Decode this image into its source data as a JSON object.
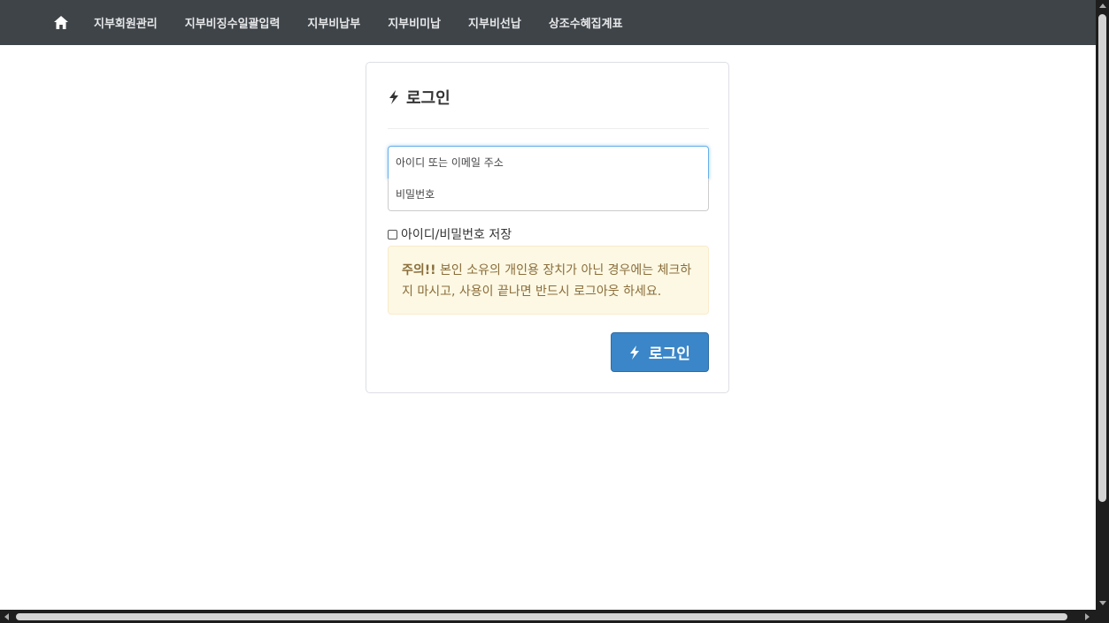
{
  "navbar": {
    "home_icon": "home-icon",
    "items": [
      {
        "label": "지부회원관리"
      },
      {
        "label": "지부비징수일괄입력"
      },
      {
        "label": "지부비납부"
      },
      {
        "label": "지부비미납"
      },
      {
        "label": "지부비선납"
      },
      {
        "label": "상조수혜집계표"
      }
    ]
  },
  "login": {
    "title_icon": "bolt-icon",
    "title": "로그인",
    "id_placeholder": "아이디 또는 이메일 주소",
    "password_placeholder": "비밀번호",
    "remember_label": "아이디/비밀번호 저장",
    "remember_checked": false,
    "alert_strong": "주의!!",
    "alert_text": " 본인 소유의 개인용 장치가 아닌 경우에는 체크하지 마시고, 사용이 끝나면 반드시 로그아웃 하세요.",
    "button_icon": "bolt-icon",
    "button_label": "로그인"
  },
  "colors": {
    "navbar_bg": "#3f4449",
    "primary": "#3a86c8",
    "alert_bg": "#fcf8e3",
    "alert_text": "#8a6d3b"
  }
}
